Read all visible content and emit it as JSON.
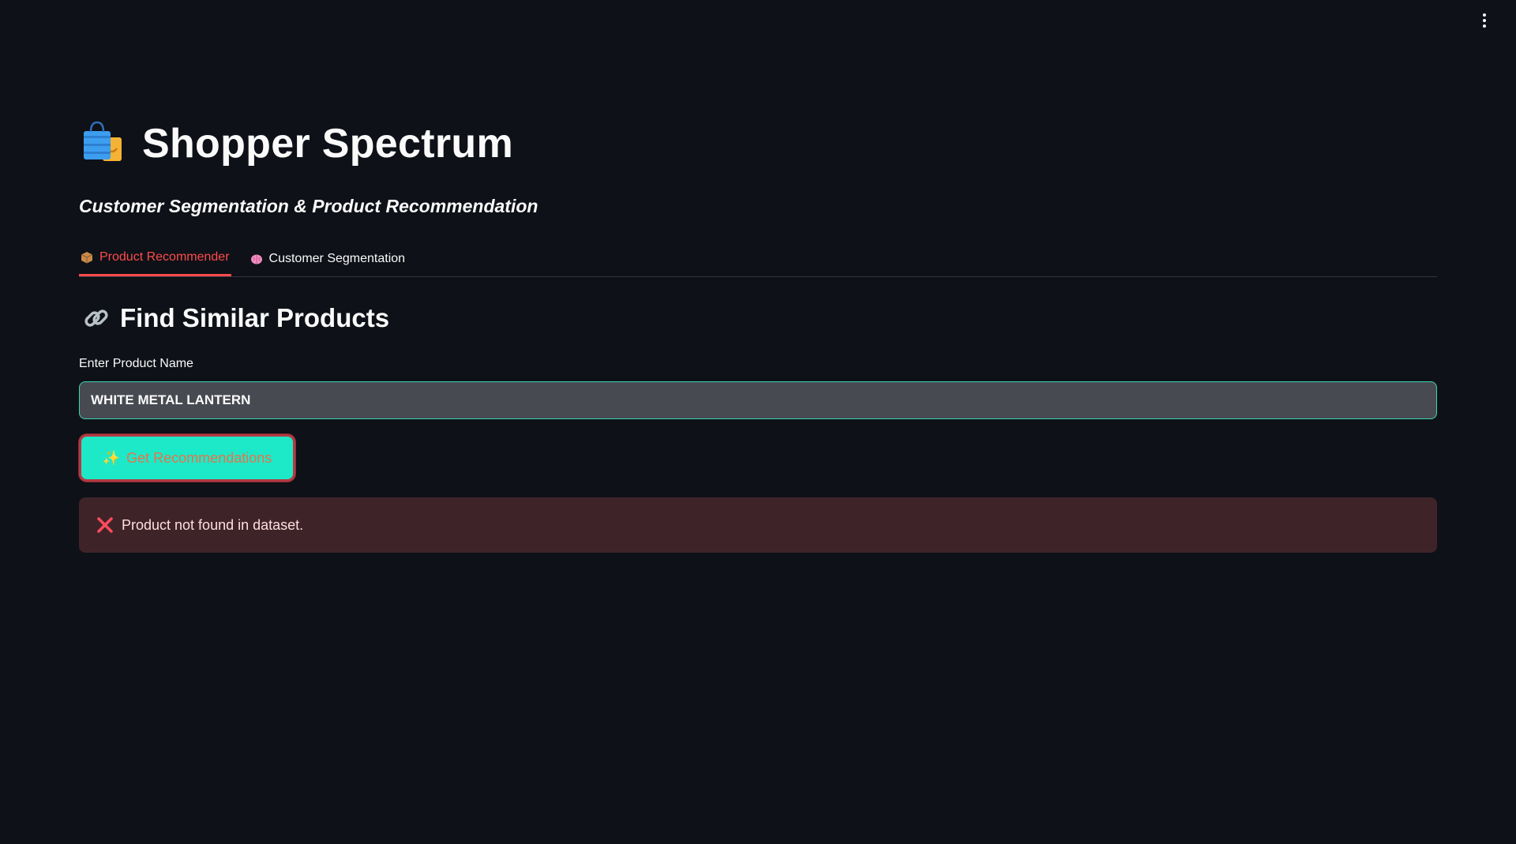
{
  "app": {
    "title": "Shopper Spectrum",
    "subtitle": "Customer Segmentation & Product Recommendation"
  },
  "tabs": [
    {
      "label": "Product Recommender",
      "icon": "package-icon",
      "active": true
    },
    {
      "label": "Customer Segmentation",
      "icon": "brain-icon",
      "active": false
    }
  ],
  "section": {
    "title": "Find Similar Products",
    "icon": "link-icon"
  },
  "input": {
    "label": "Enter Product Name",
    "value": "WHITE METAL LANTERN"
  },
  "button": {
    "label": "Get Recommendations",
    "icon": "sparkles-icon"
  },
  "alert": {
    "message": "Product not found in dataset.",
    "icon": "cross-mark-icon"
  },
  "colors": {
    "background": "#0e1117",
    "accent": "#ff4b4b",
    "button": "#1de9c8",
    "alert_bg": "#3e2429"
  }
}
